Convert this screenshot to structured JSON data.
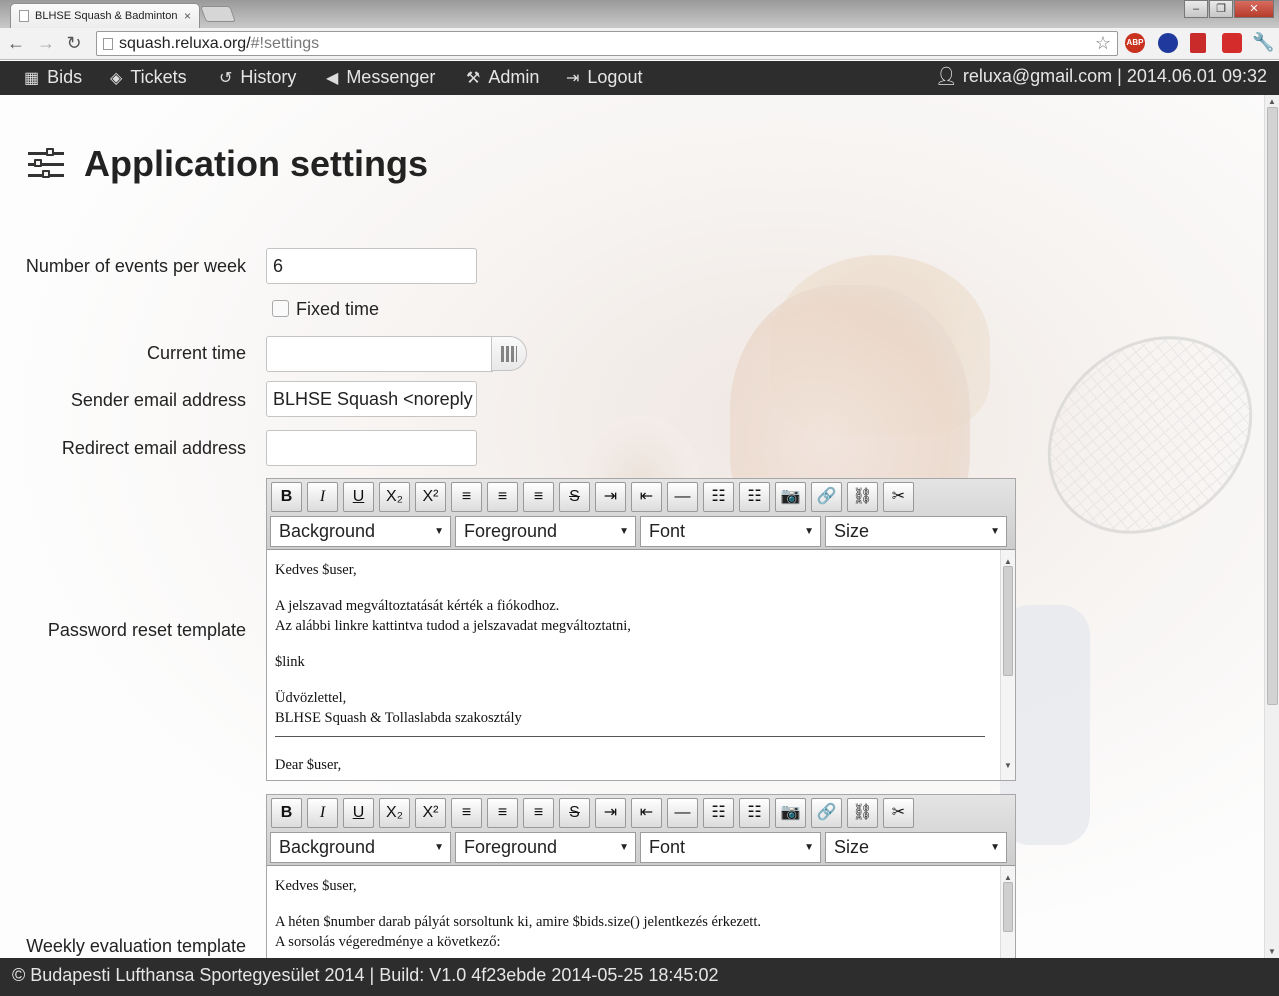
{
  "browser": {
    "tab_title": "BLHSE Squash & Badminton",
    "tab_close": "×",
    "url_host": "squash.reluxa.org/",
    "url_path": "#!settings",
    "win_min": "–",
    "win_max": "❐",
    "win_close": "✕",
    "ext_abp": "ABP"
  },
  "nav": {
    "items": [
      {
        "label": "Bids",
        "icon": "calendar-icon"
      },
      {
        "label": "Tickets",
        "icon": "ticket-icon"
      },
      {
        "label": "History",
        "icon": "history-icon"
      },
      {
        "label": "Messenger",
        "icon": "megaphone-icon"
      },
      {
        "label": "Admin",
        "icon": "wrench-icon"
      },
      {
        "label": "Logout",
        "icon": "logout-icon"
      }
    ],
    "user_info": "reluxa@gmail.com | 2014.06.01 09:32"
  },
  "page": {
    "title": "Application settings"
  },
  "form": {
    "events_label": "Number of events per week",
    "events_value": "6",
    "fixed_time_label": "Fixed time",
    "current_time_label": "Current time",
    "current_time_value": "",
    "sender_label": "Sender email address",
    "sender_value": "BLHSE Squash <noreply",
    "redirect_label": "Redirect email address",
    "redirect_value": "",
    "password_label": "Password reset template",
    "weekly_label": "Weekly evaluation template"
  },
  "editor_toolbar": {
    "buttons": [
      "B",
      "I",
      "U",
      "X₂",
      "X²",
      "≡",
      "≡",
      "≡",
      "S",
      "⇥",
      "⇤",
      "—",
      "☷",
      "☷",
      "📷",
      "🔗",
      "⛓",
      "✂"
    ],
    "selects": [
      "Background",
      "Foreground",
      "Font",
      "Size"
    ]
  },
  "password_template": {
    "lines": [
      "Kedves $user,",
      "A jelszavad megváltoztatását kérték a fiókodhoz.",
      "Az alábbi linkre kattintva tudod a jelszavadat megváltoztatni,",
      "$link",
      "Üdvözlettel,",
      "BLHSE Squash & Tollaslabda szakosztály",
      "Dear $user,"
    ]
  },
  "weekly_template": {
    "lines": [
      "Kedves $user,",
      "A héten $number darab pályát sorsoltunk ki, amire $bids.size() jelentkezés érkezett.",
      "A sorsolás végeredménye a következő:"
    ]
  },
  "footer": {
    "text": "© Budapesti Lufthansa Sportegyesület 2014 | Build: V1.0 4f23ebde 2014-05-25 18:45:02"
  }
}
